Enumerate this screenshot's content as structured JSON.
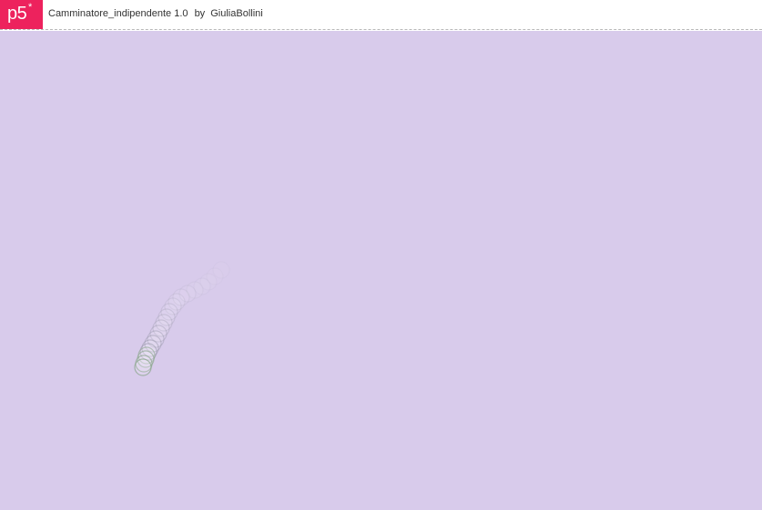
{
  "header": {
    "logo_text": "p5",
    "logo_star": "*",
    "sketch_title": "Camminatore_indipendente 1.0",
    "by_label": "by",
    "author": "GiuliaBollini"
  },
  "colors": {
    "brand": "#ed225d",
    "canvas_background": "#d8cbeb",
    "walker_stroke": "#8c8c9e",
    "walker_stroke_recent": "#7fa07f"
  },
  "icons": {
    "logo": "p5-logo-icon"
  },
  "sketch": {
    "walker_count": 1,
    "trail_visible": true
  }
}
